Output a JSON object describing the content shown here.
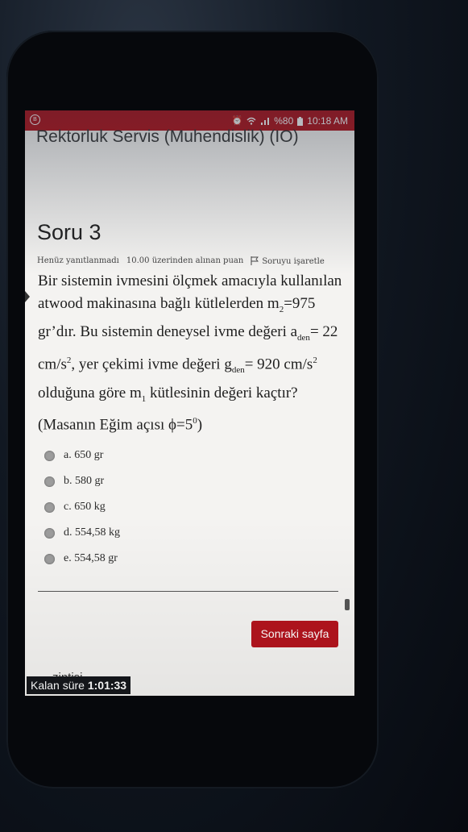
{
  "status_bar": {
    "battery": "%80",
    "time": "10:18 AM"
  },
  "app": {
    "title": "Rektorluk Servis (Muhendislik) (IO)"
  },
  "question": {
    "title": "Soru 3",
    "state": "Henüz yanıtlanmadı",
    "points": "10.00 üzerinden alınan puan",
    "flag_label": "Soruyu işaretle",
    "text_parts": {
      "p1": "Bir sistemin ivmesini ölçmek amacıyla kullanılan atwood makinasına bağlı kütlelerden m",
      "sub1": "2",
      "p2": "=975 gr’dır. Bu sistemin deneysel ivme değeri a",
      "sub2": "den",
      "p3": "= 22 cm/s",
      "sup1": "2",
      "p4": ", yer çekimi ivme değeri g",
      "sub3": "den",
      "p5": "= 920 cm/s",
      "sup2": "2",
      "p6": " olduğuna göre m",
      "sub4": "1",
      "p7": " kütlesinin değeri kaçtır? (Masanın Eğim açısı ϕ=5",
      "sup3": "0",
      "p8": ")"
    },
    "options": [
      "a. 650 gr",
      "b. 580 gr",
      "c. 650 kg",
      "d. 554,58 kg",
      "e. 554,58 gr"
    ]
  },
  "footer": {
    "next_button": "Sonraki sayfa",
    "nav_text": "zintisi",
    "timer_label": "Kalan süre",
    "timer_value": "1:01:33"
  },
  "colors": {
    "accent": "#b2161f",
    "background": "#f4f3f1"
  }
}
